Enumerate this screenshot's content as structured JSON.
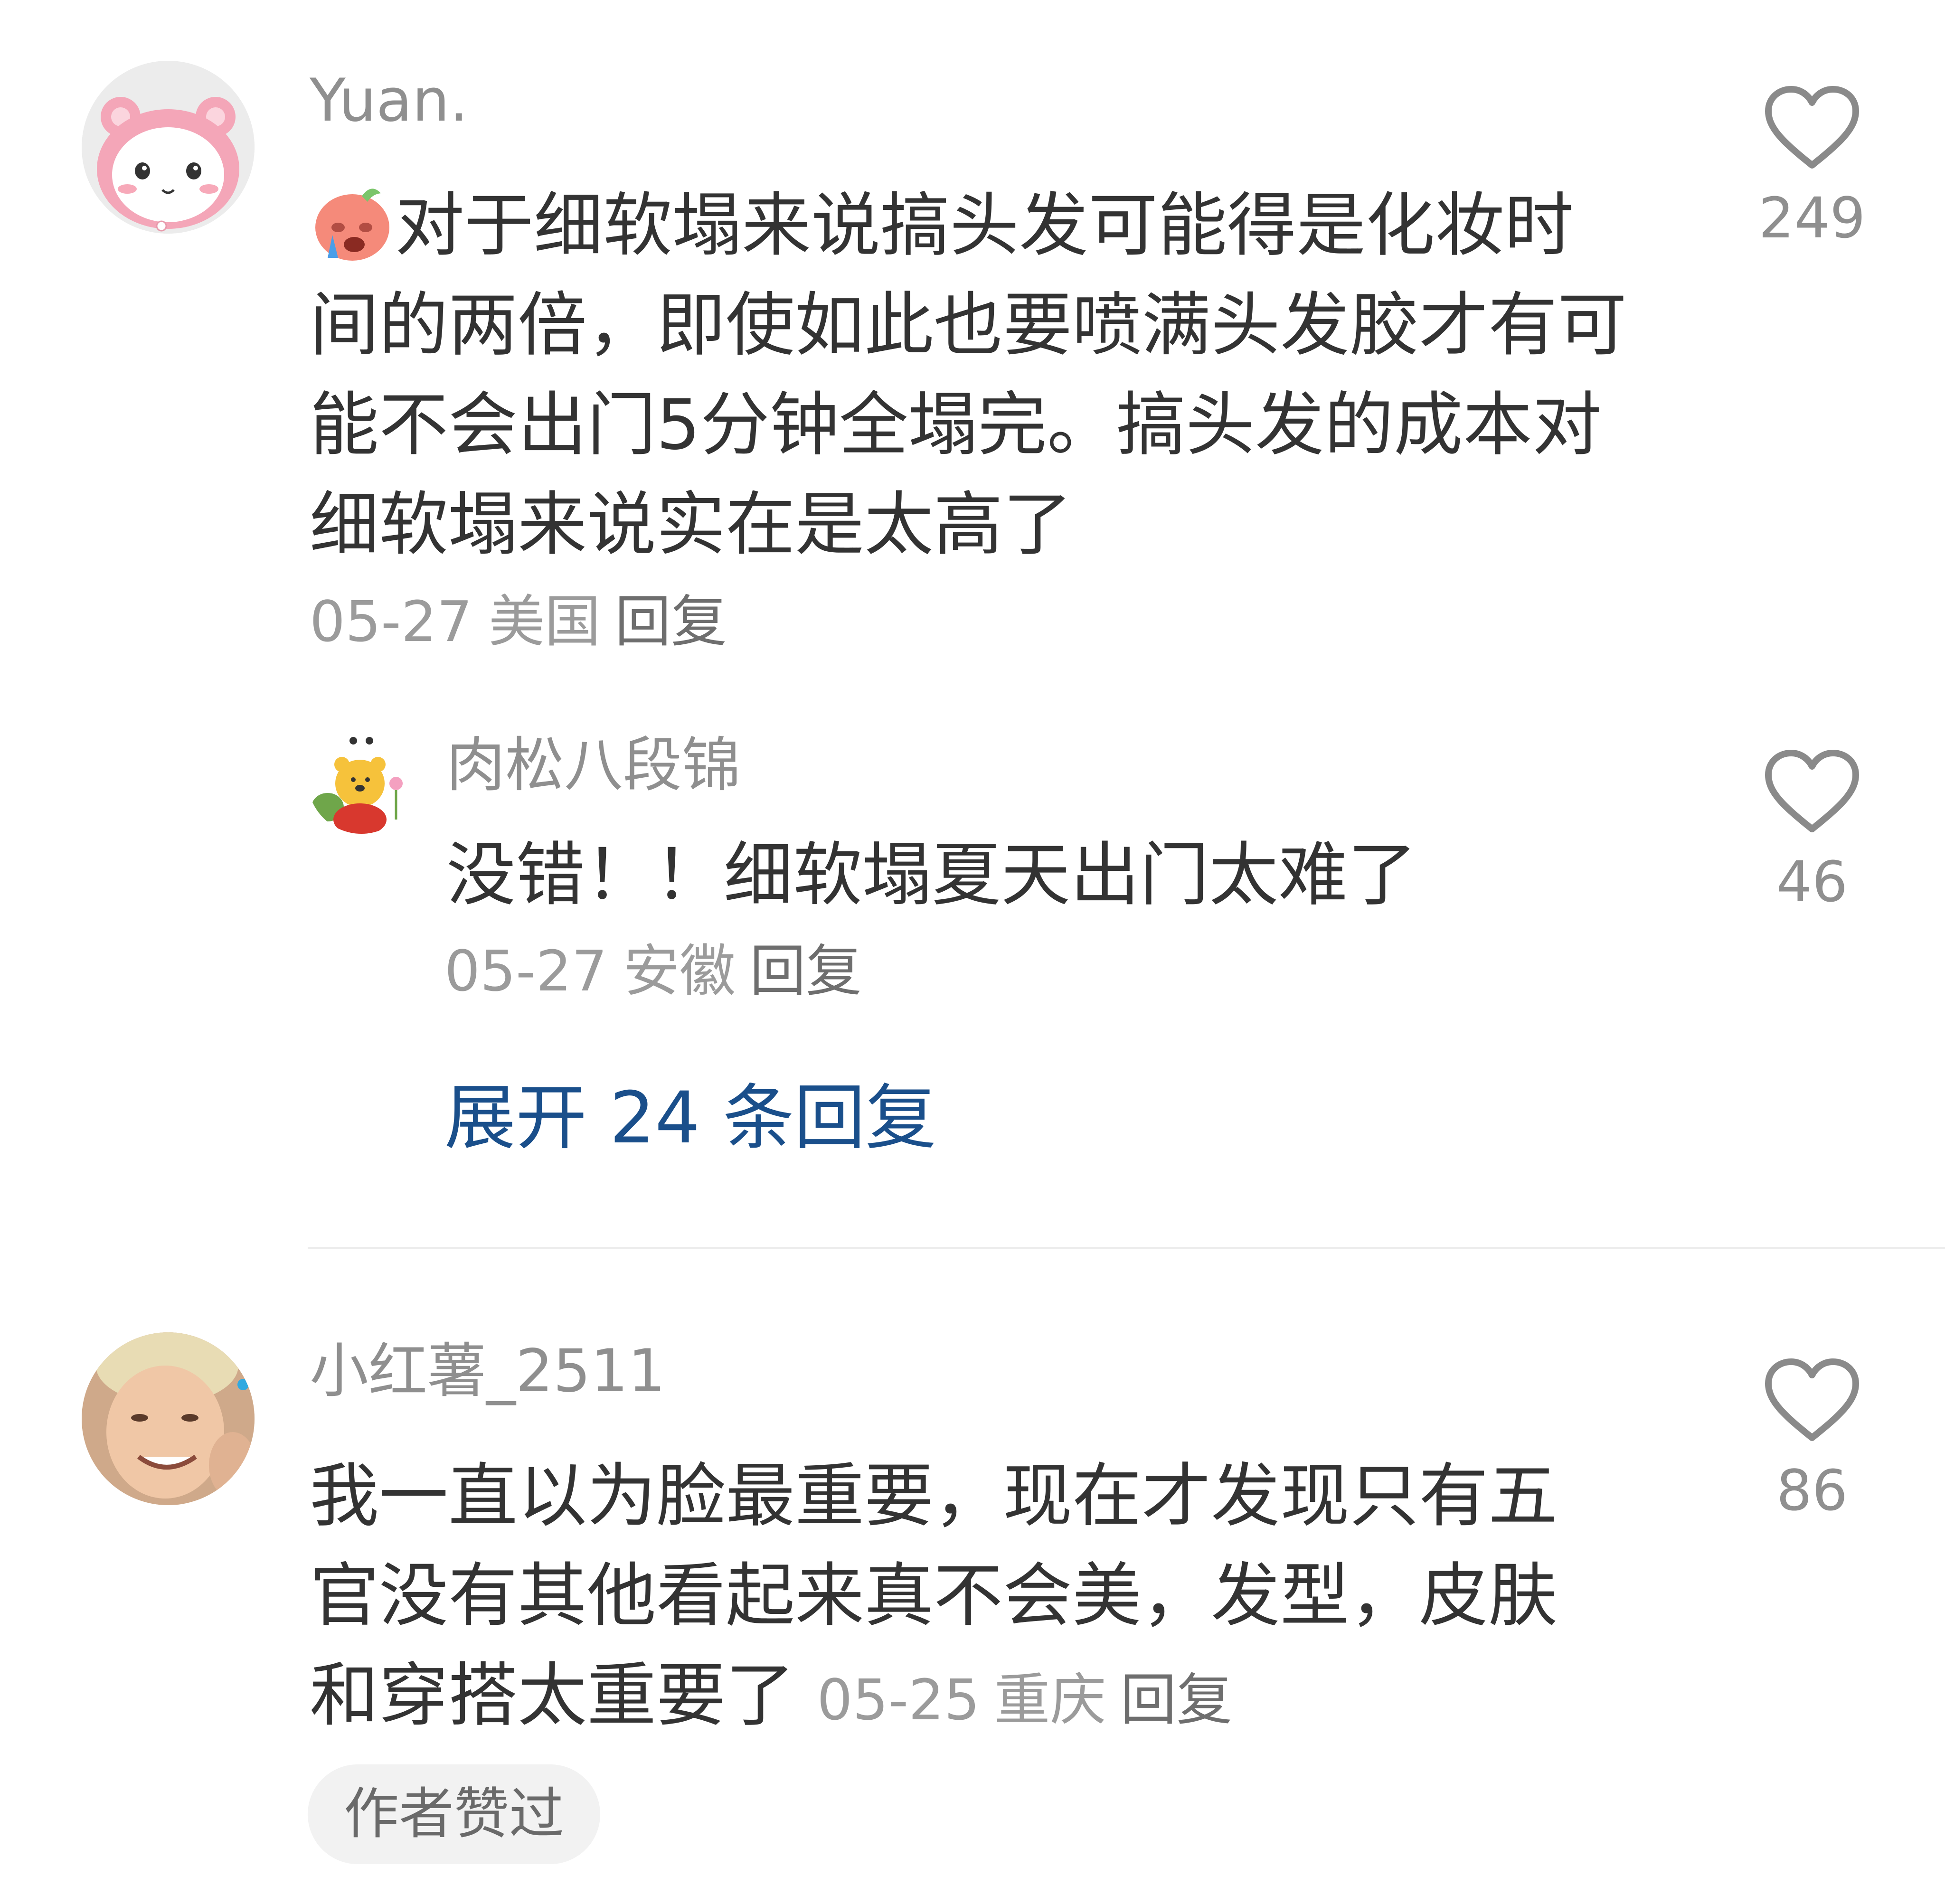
{
  "comments": [
    {
      "username": "Yuan.",
      "emoji": "crying-face-emoji",
      "content": "对于细软塌来说搞头发可能得是化妆时间的两倍，即使如此也要喷满头发胶才有可能不会出门5分钟全塌完。搞头发的成本对细软塌来说实在是太高了",
      "date": "05-27",
      "location": "美国",
      "reply_label": "回复",
      "likes": "249",
      "avatar_icon": "pink-bear-avatar",
      "replies": [
        {
          "username": "肉松八段锦",
          "content": "没错！！细软塌夏天出门太难了",
          "date": "05-27",
          "location": "安徽",
          "reply_label": "回复",
          "likes": "46",
          "avatar_icon": "pooh-bear-avatar"
        }
      ],
      "expand_label": "展开 24 条回复"
    },
    {
      "username": "小红薯_2511",
      "content": "我一直以为脸最重要，现在才发现只有五官没有其他看起来真不会美，发型，皮肤和穿搭太重要了",
      "date": "05-25",
      "location": "重庆",
      "reply_label": "回复",
      "likes": "86",
      "avatar_icon": "photo-avatar",
      "badge": "作者赞过"
    }
  ],
  "colors": {
    "username": "#8f8f8f",
    "content": "#333333",
    "meta": "#9b9b9b",
    "link": "#1a4f8b",
    "heart_stroke": "#8a8a8a"
  }
}
